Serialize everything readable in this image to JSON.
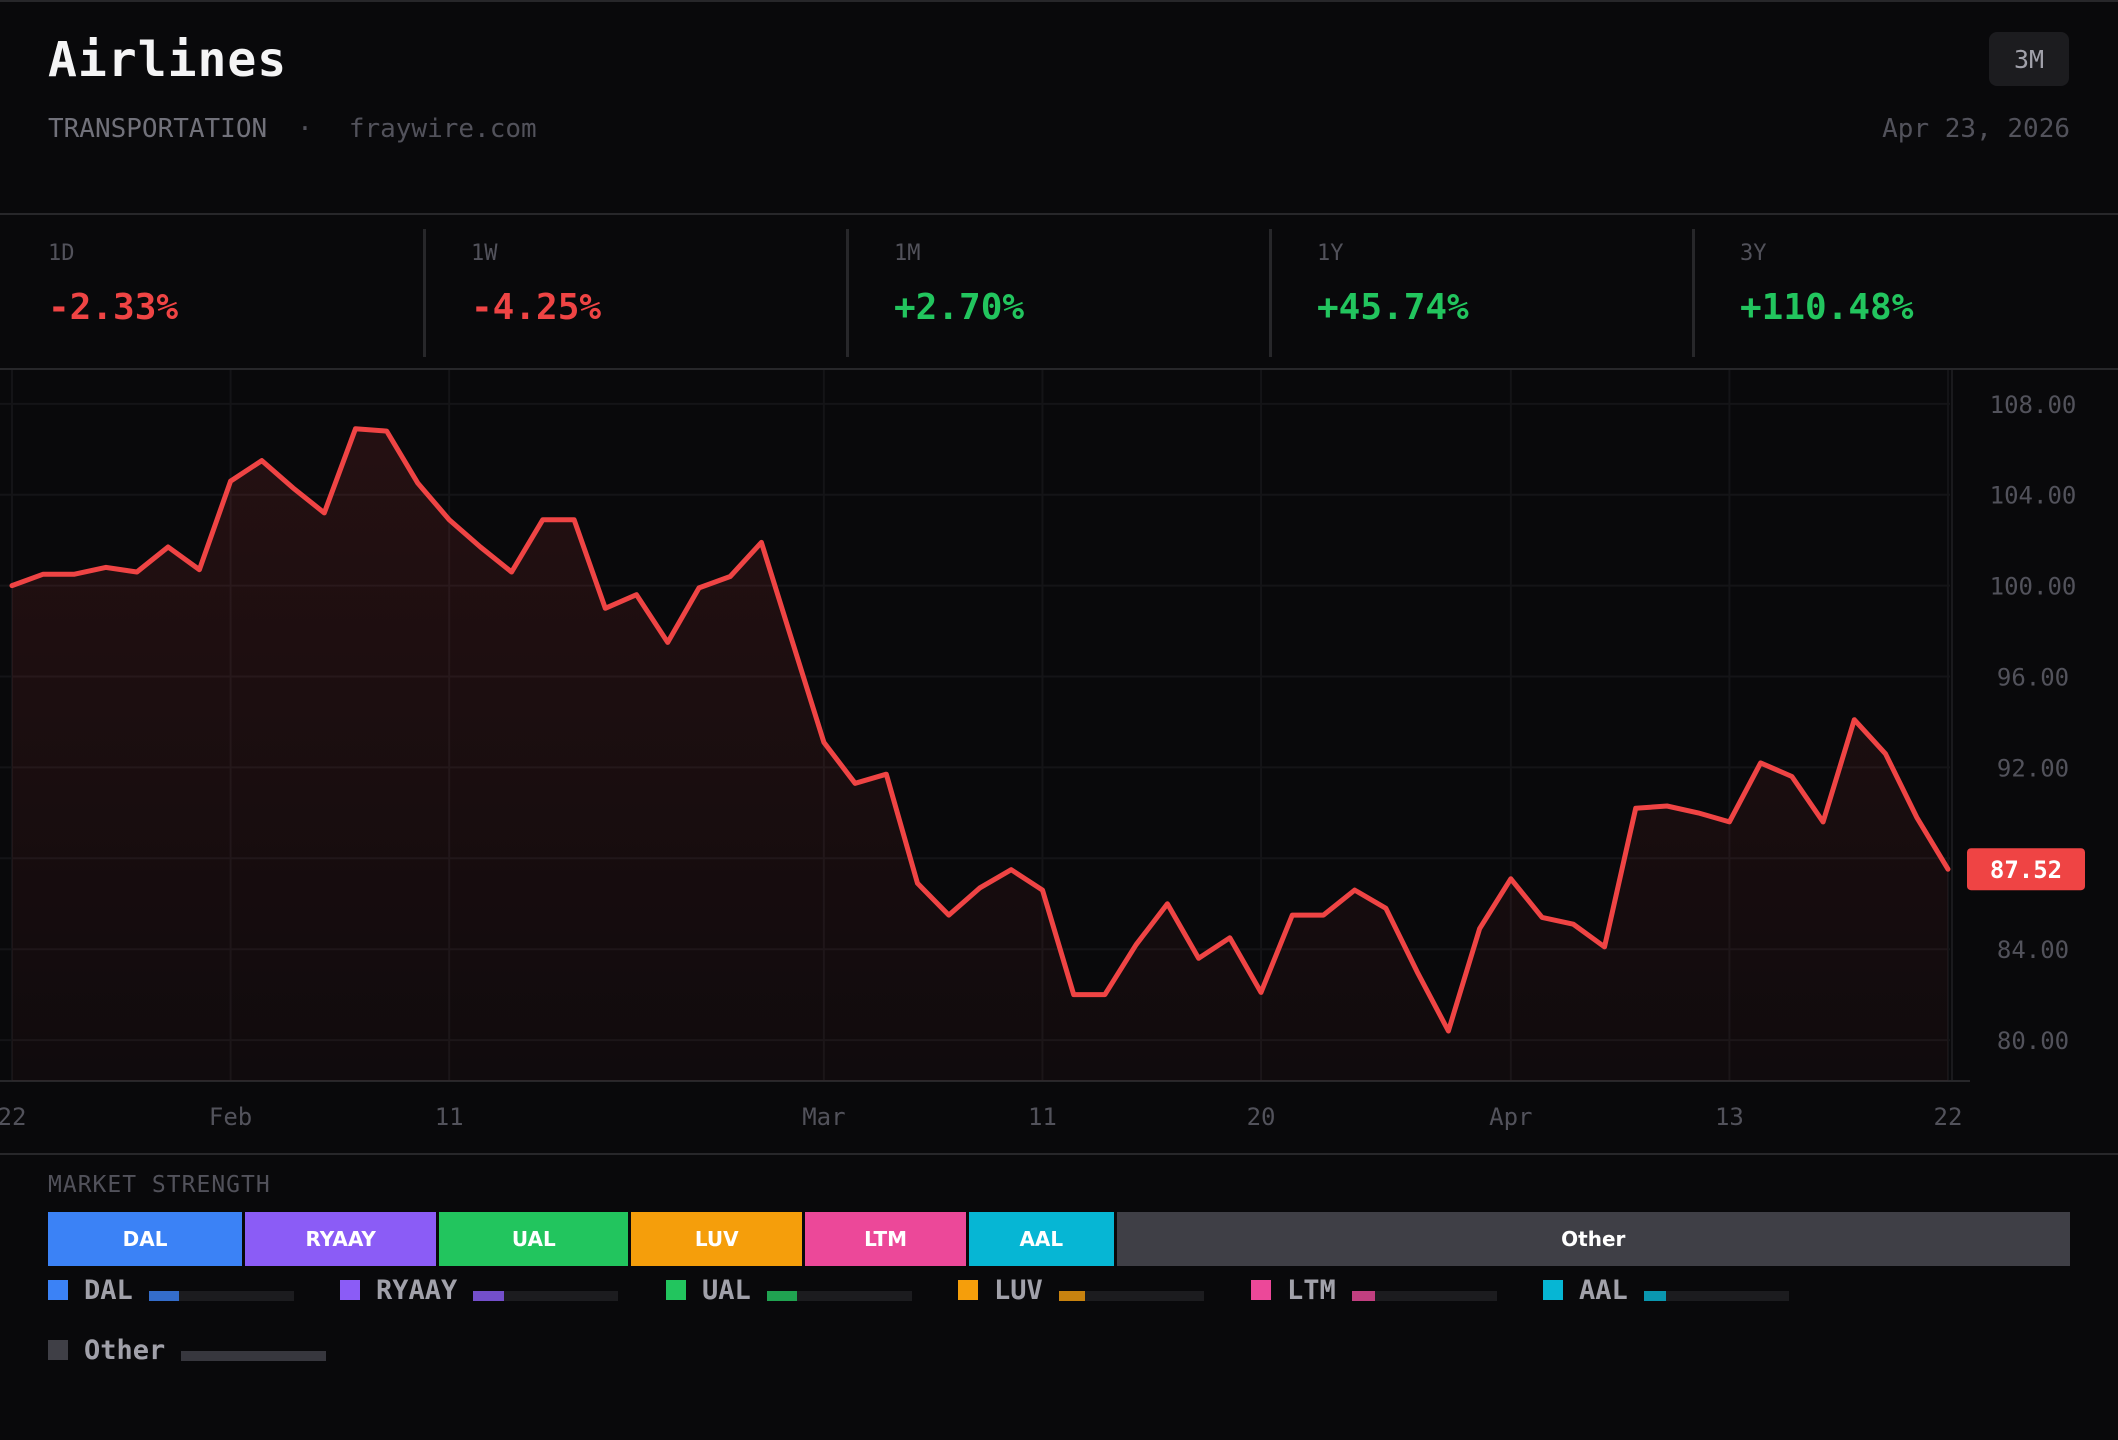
{
  "header": {
    "title": "Airlines",
    "category": "TRANSPORTATION",
    "separator": "·",
    "site": "fraywire.com",
    "range_button": "3M",
    "date": "Apr 23, 2026"
  },
  "performance": [
    {
      "label": "1D",
      "value": "-2.33%",
      "direction": "down"
    },
    {
      "label": "1W",
      "value": "-4.25%",
      "direction": "down"
    },
    {
      "label": "1M",
      "value": "+2.70%",
      "direction": "up"
    },
    {
      "label": "1Y",
      "value": "+45.74%",
      "direction": "up"
    },
    {
      "label": "3Y",
      "value": "+110.48%",
      "direction": "up"
    }
  ],
  "chart_data": {
    "type": "line",
    "line_color": "#ef4444",
    "x": [
      "Jan 22",
      "Jan 23",
      "Jan 26",
      "Jan 27",
      "Jan 28",
      "Jan 29",
      "Jan 30",
      "Feb 2",
      "Feb 3",
      "Feb 4",
      "Feb 5",
      "Feb 6",
      "Feb 9",
      "Feb 10",
      "Feb 11",
      "Feb 12",
      "Feb 13",
      "Feb 17",
      "Feb 18",
      "Feb 19",
      "Feb 20",
      "Feb 23",
      "Feb 24",
      "Feb 25",
      "Feb 26",
      "Feb 27",
      "Mar 2",
      "Mar 3",
      "Mar 4",
      "Mar 5",
      "Mar 6",
      "Mar 9",
      "Mar 10",
      "Mar 11",
      "Mar 12",
      "Mar 13",
      "Mar 16",
      "Mar 17",
      "Mar 18",
      "Mar 19",
      "Mar 20",
      "Mar 23",
      "Mar 24",
      "Mar 25",
      "Mar 26",
      "Mar 27",
      "Mar 30",
      "Mar 31",
      "Apr 1",
      "Apr 2",
      "Apr 6",
      "Apr 7",
      "Apr 8",
      "Apr 9",
      "Apr 10",
      "Apr 13",
      "Apr 14",
      "Apr 15",
      "Apr 16",
      "Apr 17",
      "Apr 20",
      "Apr 21",
      "Apr 22"
    ],
    "values": [
      100.0,
      100.5,
      100.5,
      100.8,
      100.6,
      101.7,
      100.7,
      104.6,
      105.5,
      104.3,
      103.2,
      106.9,
      106.8,
      104.5,
      102.9,
      101.7,
      100.6,
      102.9,
      102.9,
      99.0,
      99.6,
      97.5,
      99.9,
      100.4,
      101.9,
      97.5,
      93.1,
      91.3,
      91.7,
      86.9,
      85.5,
      86.7,
      87.5,
      86.6,
      82.0,
      82.0,
      84.2,
      86.0,
      83.6,
      84.5,
      82.1,
      85.5,
      85.5,
      86.6,
      85.8,
      83.0,
      80.4,
      84.9,
      87.1,
      85.4,
      85.1,
      84.1,
      90.2,
      90.3,
      90.0,
      89.6,
      92.2,
      91.6,
      89.6,
      94.1,
      92.6,
      89.8,
      87.52
    ],
    "last_value_label": "87.52",
    "x_ticks": [
      "22",
      "Feb",
      "11",
      "Mar",
      "11",
      "20",
      "Apr",
      "13",
      "22"
    ],
    "y_ticks": [
      "108.00",
      "104.00",
      "100.00",
      "96.00",
      "92.00",
      "84.00",
      "80.00"
    ],
    "ylim": [
      78.2,
      109.4
    ],
    "grid": true
  },
  "market_strength": {
    "title": "MARKET STRENGTH",
    "segments": [
      {
        "name": "DAL",
        "share": 9.75,
        "color": "#3b82f6",
        "strength": 0.21
      },
      {
        "name": "RYAAY",
        "share": 9.6,
        "color": "#8b5cf6",
        "strength": 0.21
      },
      {
        "name": "UAL",
        "share": 9.5,
        "color": "#22c55e",
        "strength": 0.21
      },
      {
        "name": "LUV",
        "share": 8.6,
        "color": "#f59e0b",
        "strength": 0.18
      },
      {
        "name": "LTM",
        "share": 8.1,
        "color": "#ec4899",
        "strength": 0.16
      },
      {
        "name": "AAL",
        "share": 7.3,
        "color": "#06b6d4",
        "strength": 0.15
      },
      {
        "name": "Other",
        "share": 47.15,
        "color": "#3f3f46",
        "strength": 1.0
      }
    ]
  }
}
